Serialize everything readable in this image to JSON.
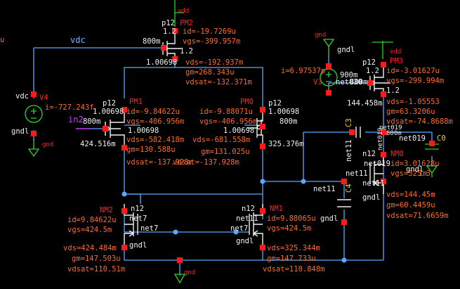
{
  "window": {
    "title": ""
  },
  "colors": {
    "background": "#000000",
    "wire": "#5aa8ff",
    "device": "#f0f0f0",
    "params": "#ff6a2a",
    "power": "#2bd42b",
    "pins": "#ff1a1a",
    "inst": "#ff2a2a",
    "cap_label": "#f5d000",
    "input_pin": "#c040ff"
  },
  "labels": {
    "vdc_net": "vdc",
    "in2_net": "in2",
    "u_edge": "u",
    "vdd1": "vdd",
    "vdd2": "vdd",
    "gnd_top": "gnd",
    "gnd_v4": "gnd",
    "gnd_bottom": "gnd",
    "gndl_v3": "gndl",
    "gndl_v4": "gndl",
    "gndl_nm2": "gndl",
    "gndl_nm1": "gndl",
    "gndl_c4": "gndl",
    "gndl_nm0": "gndl",
    "gndl_c0": "gndl",
    "net7_a": "net7",
    "net7_b": "net7",
    "net7_c": "net7",
    "net11_a": "net11",
    "net11_b": "net11",
    "net11_c": "net11",
    "net11_d": "net11",
    "net11_e": "net11",
    "net019_a": "net019",
    "net019_b": "net019",
    "net019_c": "net019",
    "net019_d": "net019",
    "net030": "net030",
    "w_800_a": "800m",
    "w_800_b": "800m",
    "w_800_c": "800m",
    "w_800_d": "800m",
    "w_800_e": "800m",
    "v_1p2_a": "1.2",
    "v_1p2_b": "1.2",
    "v_1p2_c": "1.2",
    "v_1p2_d": "1.2"
  },
  "V4": {
    "name": "V4",
    "label": "vdc",
    "i": "i=-727.243f"
  },
  "V3": {
    "name": "V3",
    "i": "i=6.97537p",
    "val": "900m"
  },
  "PM2": {
    "name": "PM2",
    "model": "p12",
    "id": "id=-19.7269u",
    "vgs": "vgs=-399.957m",
    "vds": "vds=-192.937m",
    "gm": "gm=268.343u",
    "vdsat": "vdsat=-132.371m",
    "node": "1.00698"
  },
  "PM1": {
    "name": "PM1",
    "model": "p12",
    "id": "id=-9.84622u",
    "vgs": "vgs=-406.956m",
    "vds": "vds=-582.418m",
    "gm": "gm=130.588u",
    "vdsat": "vdsat=-137.928m",
    "n1": "1.00698",
    "n2": "1.00698",
    "src": "424.516m"
  },
  "PM0": {
    "name": "PM0",
    "model": "p12",
    "id": "id=-9.88071u",
    "vgs": "vgs=-406.956m",
    "vds": "vds=-681.558m",
    "gm": "gm=131.025u",
    "vdsat": "vdsat=-137.928m",
    "n1": "1.00698",
    "n2": "1.00698",
    "src": "325.376m"
  },
  "PM3": {
    "name": "PM3",
    "model": "p12",
    "id": "id=-3.01627u",
    "vgs": "vgs=-299.994m",
    "vds": "vds=-1.05553",
    "gm": "gm=63.3206u",
    "vdsat": "vdsat=-74.8688m",
    "node": "144.458m"
  },
  "NM2": {
    "name": "NM2",
    "model": "n12",
    "id": "id=9.84622u",
    "vgs": "vgs=424.5m",
    "vds": "vds=424.484m",
    "gm": "gm=147.503u",
    "vdsat": "vdsat=110.51m"
  },
  "NM1": {
    "name": "NM1",
    "model": "n12",
    "id": "id=9.88065u",
    "vgs": "vgs=424.5m",
    "vds": "vds=325.344m",
    "gm": "gm=147.733u",
    "vdsat": "vdsat=110.848m"
  },
  "NM0": {
    "name": "NM0",
    "model": "n12",
    "id": "id=3.01628u",
    "vgs": "vgs=325.3",
    "vgs_tail": "1m",
    "vds": "vds=144.45m",
    "gm": "gm=60.4459u",
    "vdsat": "vdsat=71.6659m"
  },
  "C3": {
    "name": "C3"
  },
  "C4": {
    "name": "C4"
  },
  "C0": {
    "name": "C0"
  }
}
